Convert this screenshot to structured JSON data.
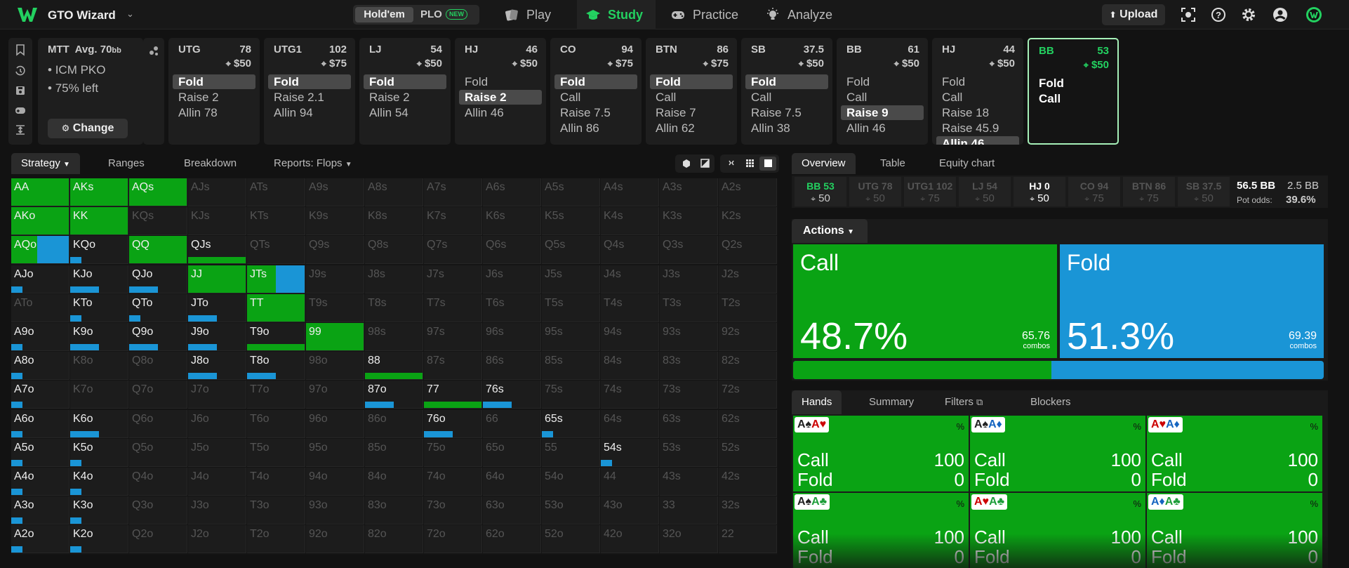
{
  "topbar": {
    "brand": "GTO Wizard",
    "game_holdem": "Hold'em",
    "game_plo": "PLO",
    "new_badge": "NEW",
    "nav": [
      "Play",
      "Study",
      "Practice",
      "Analyze"
    ],
    "active_nav": "Study",
    "upload": "Upload"
  },
  "mtt": {
    "title": "MTT",
    "avg_label": "Avg. 70",
    "avg_unit": "bb",
    "lines": [
      "ICM PKO",
      "75% left"
    ],
    "change": "Change"
  },
  "positions": [
    {
      "name": "UTG",
      "stack": "78",
      "ante": "$50",
      "actions": [
        "Fold",
        "Raise 2",
        "Allin 78"
      ],
      "selected": 0
    },
    {
      "name": "UTG1",
      "stack": "102",
      "ante": "$75",
      "actions": [
        "Fold",
        "Raise 2.1",
        "Allin 94"
      ],
      "selected": 0
    },
    {
      "name": "LJ",
      "stack": "54",
      "ante": "$50",
      "actions": [
        "Fold",
        "Raise 2",
        "Allin 54"
      ],
      "selected": 0
    },
    {
      "name": "HJ",
      "stack": "46",
      "ante": "$50",
      "actions": [
        "Fold",
        "Raise 2",
        "Allin 46"
      ],
      "selected": 1
    },
    {
      "name": "CO",
      "stack": "94",
      "ante": "$75",
      "actions": [
        "Fold",
        "Call",
        "Raise 7.5",
        "Allin 86"
      ],
      "selected": 0
    },
    {
      "name": "BTN",
      "stack": "86",
      "ante": "$75",
      "actions": [
        "Fold",
        "Call",
        "Raise 7",
        "Allin 62"
      ],
      "selected": 0
    },
    {
      "name": "SB",
      "stack": "37.5",
      "ante": "$50",
      "actions": [
        "Fold",
        "Call",
        "Raise 7.5",
        "Allin 38"
      ],
      "selected": 0
    },
    {
      "name": "BB",
      "stack": "61",
      "ante": "$50",
      "actions": [
        "Fold",
        "Call",
        "Raise 9",
        "Allin 46"
      ],
      "selected": 2
    },
    {
      "name": "HJ",
      "stack": "44",
      "ante": "$50",
      "actions": [
        "Fold",
        "Call",
        "Raise 18",
        "Raise 45.9",
        "Allin 46"
      ],
      "selected": 4
    },
    {
      "name": "BB",
      "stack": "53",
      "ante": "$50",
      "actions": [
        "Fold",
        "Call"
      ],
      "selected": -1,
      "active": true
    }
  ],
  "strategy_tabs": [
    "Strategy",
    "Ranges",
    "Breakdown",
    "Reports: Flops"
  ],
  "grid": {
    "ranks": [
      "A",
      "K",
      "Q",
      "J",
      "T",
      "9",
      "8",
      "7",
      "6",
      "5",
      "4",
      "3",
      "2"
    ],
    "call_color": "#0aa314",
    "fold_color": "#1a95d6",
    "call_freq": [
      [
        1,
        1,
        1,
        0,
        0,
        0,
        0,
        0,
        0,
        0,
        0,
        0,
        0
      ],
      [
        1,
        1,
        0,
        0,
        0,
        0,
        0,
        0,
        0,
        0,
        0,
        0,
        0
      ],
      [
        0.45,
        0.02,
        1,
        0.1,
        0,
        0,
        0,
        0,
        0,
        0,
        0,
        0,
        0
      ],
      [
        0.02,
        0.05,
        0.05,
        1,
        0.5,
        0,
        0,
        0,
        0,
        0,
        0,
        0,
        0
      ],
      [
        0,
        0.02,
        0.02,
        0.05,
        1,
        0,
        0,
        0,
        0,
        0,
        0,
        0,
        0
      ],
      [
        0.02,
        0.05,
        0.05,
        0.05,
        0.1,
        1,
        0,
        0,
        0,
        0,
        0,
        0,
        0
      ],
      [
        0.02,
        0,
        0,
        0.05,
        0.05,
        0,
        0.2,
        0,
        0,
        0,
        0,
        0,
        0
      ],
      [
        0.02,
        0,
        0,
        0,
        0,
        0,
        0.05,
        0.1,
        0.05,
        0,
        0,
        0,
        0
      ],
      [
        0.02,
        0.05,
        0,
        0,
        0,
        0,
        0,
        0.05,
        0,
        0.02,
        0,
        0,
        0
      ],
      [
        0.02,
        0.02,
        0,
        0,
        0,
        0,
        0,
        0,
        0,
        0,
        0.02,
        0,
        0
      ],
      [
        0.02,
        0.02,
        0,
        0,
        0,
        0,
        0,
        0,
        0,
        0,
        0,
        0,
        0
      ],
      [
        0.02,
        0.02,
        0,
        0,
        0,
        0,
        0,
        0,
        0,
        0,
        0,
        0,
        0
      ],
      [
        0.02,
        0.02,
        0,
        0,
        0,
        0,
        0,
        0,
        0,
        0,
        0,
        0,
        0
      ]
    ],
    "fold_freq": [
      [
        0,
        0,
        0,
        1,
        1,
        1,
        1,
        1,
        1,
        1,
        1,
        1,
        1
      ],
      [
        0,
        0,
        1,
        1,
        1,
        1,
        1,
        1,
        1,
        1,
        1,
        1,
        1
      ],
      [
        0.55,
        0.98,
        0,
        0.9,
        1,
        1,
        1,
        1,
        1,
        1,
        1,
        1,
        1
      ],
      [
        0.98,
        0.95,
        0.95,
        0,
        0.5,
        1,
        1,
        1,
        1,
        1,
        1,
        1,
        1
      ],
      [
        1,
        0.98,
        0.98,
        0.95,
        0,
        1,
        1,
        1,
        1,
        1,
        1,
        1,
        1
      ],
      [
        0.98,
        0.95,
        0.95,
        0.95,
        0.9,
        0,
        1,
        1,
        1,
        1,
        1,
        1,
        1
      ],
      [
        0.98,
        1,
        1,
        0.95,
        0.95,
        1,
        0.8,
        1,
        1,
        1,
        1,
        1,
        1
      ],
      [
        0.98,
        1,
        1,
        1,
        1,
        1,
        0.95,
        0.9,
        0.95,
        1,
        1,
        1,
        1
      ],
      [
        0.98,
        0.95,
        1,
        1,
        1,
        1,
        1,
        0.95,
        1,
        0.98,
        1,
        1,
        1
      ],
      [
        0.98,
        0.98,
        1,
        1,
        1,
        1,
        1,
        1,
        1,
        1,
        0.98,
        1,
        1
      ],
      [
        0.98,
        0.98,
        1,
        1,
        1,
        1,
        1,
        1,
        1,
        1,
        1,
        1,
        1
      ],
      [
        0.98,
        0.98,
        1,
        1,
        1,
        1,
        1,
        1,
        1,
        1,
        1,
        1,
        1
      ],
      [
        0.98,
        0.98,
        1,
        1,
        1,
        1,
        1,
        1,
        1,
        1,
        1,
        1,
        1
      ]
    ]
  },
  "right_tabs": [
    "Overview",
    "Table",
    "Equity chart"
  ],
  "seats": [
    {
      "name": "BB 53",
      "bet": "50",
      "style": "bb"
    },
    {
      "name": "UTG 78",
      "bet": "50",
      "style": "dim"
    },
    {
      "name": "UTG1 102",
      "bet": "75",
      "style": "dim"
    },
    {
      "name": "LJ 54",
      "bet": "50",
      "style": "dim"
    },
    {
      "name": "HJ 0",
      "bet": "50",
      "style": "hj"
    },
    {
      "name": "CO 94",
      "bet": "75",
      "style": "dim"
    },
    {
      "name": "BTN 86",
      "bet": "75",
      "style": "dim"
    },
    {
      "name": "SB 37.5",
      "bet": "50",
      "style": "dim"
    }
  ],
  "pot": {
    "amount": "56.5 BB",
    "bb": "2.5 BB",
    "odds_label": "Pot odds:",
    "odds_value": "39.6%"
  },
  "actions_label": "Actions",
  "actions": [
    {
      "name": "Call",
      "pct": "48.7%",
      "combos": "65.76",
      "combos_label": "combos",
      "color": "#0aa314",
      "freq": 0.487
    },
    {
      "name": "Fold",
      "pct": "51.3%",
      "combos": "69.39",
      "combos_label": "combos",
      "color": "#1a95d6",
      "freq": 0.513
    }
  ],
  "hands_tabs": [
    "Hands",
    "Summary",
    "Filters",
    "Blockers"
  ],
  "hands": [
    {
      "cards": [
        [
          "A",
          "s"
        ],
        [
          "A",
          "h"
        ]
      ],
      "call": "100",
      "fold": "0"
    },
    {
      "cards": [
        [
          "A",
          "s"
        ],
        [
          "A",
          "d"
        ]
      ],
      "call": "100",
      "fold": "0"
    },
    {
      "cards": [
        [
          "A",
          "h"
        ],
        [
          "A",
          "d"
        ]
      ],
      "call": "100",
      "fold": "0"
    },
    {
      "cards": [
        [
          "A",
          "s"
        ],
        [
          "A",
          "c"
        ]
      ],
      "call": "100",
      "fold": "0"
    },
    {
      "cards": [
        [
          "A",
          "h"
        ],
        [
          "A",
          "c"
        ]
      ],
      "call": "100",
      "fold": "0"
    },
    {
      "cards": [
        [
          "A",
          "d"
        ],
        [
          "A",
          "c"
        ]
      ],
      "call": "100",
      "fold": "0"
    }
  ],
  "hand_row_labels": {
    "call": "Call",
    "fold": "Fold",
    "pct": "%"
  }
}
